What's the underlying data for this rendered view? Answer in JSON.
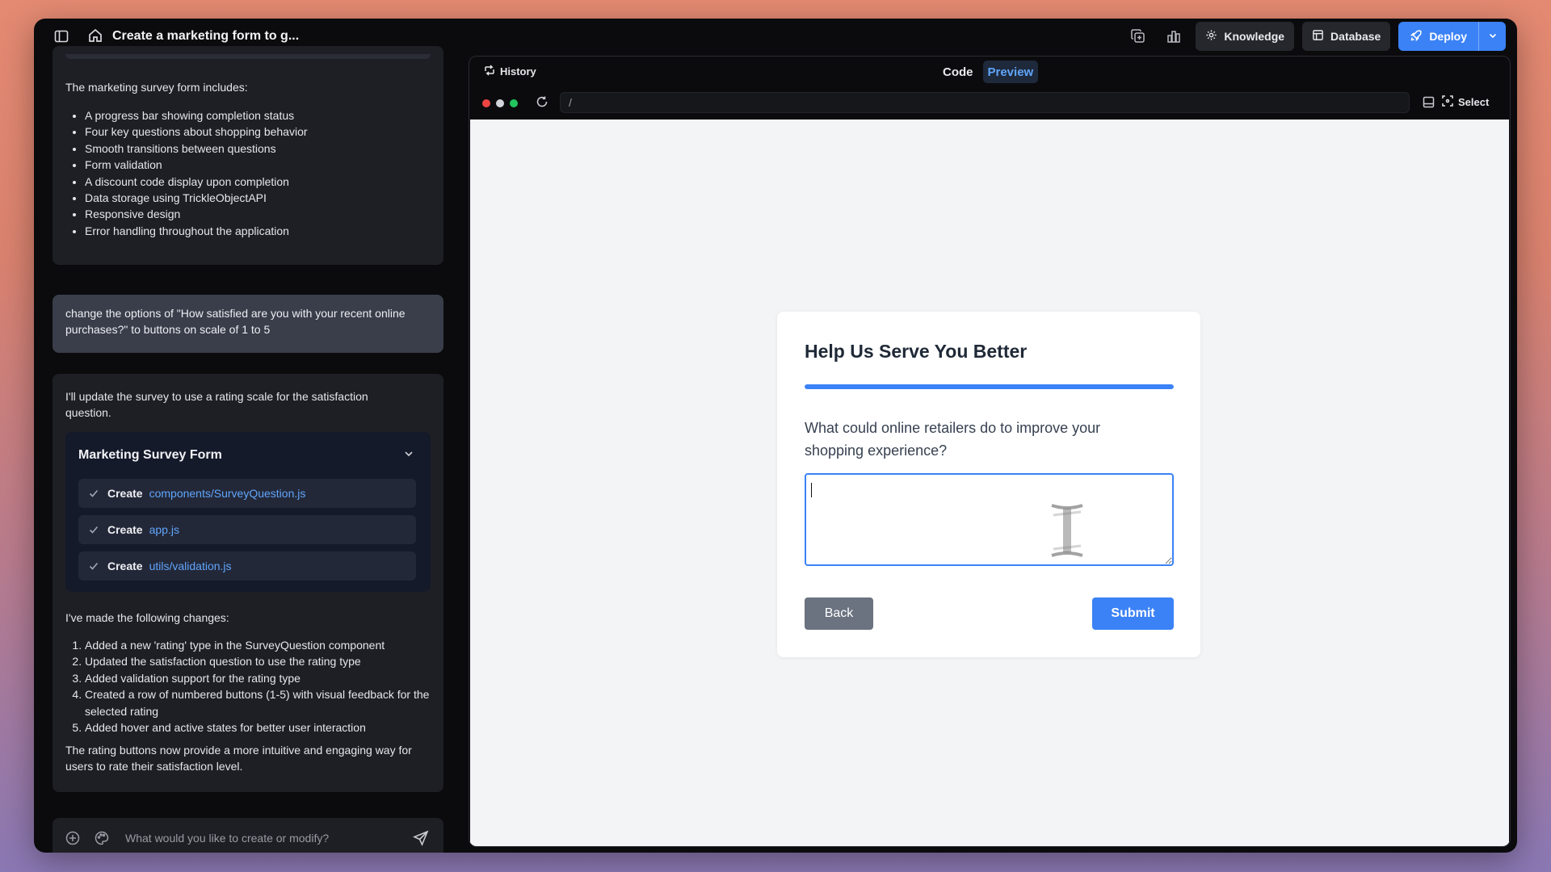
{
  "window": {
    "title": "Create a marketing form to g..."
  },
  "toolbar": {
    "knowledge_label": "Knowledge",
    "database_label": "Database",
    "deploy_label": "Deploy"
  },
  "chat": {
    "summary_intro": "The marketing survey form includes:",
    "summary_items": [
      "A progress bar showing completion status",
      "Four key questions about shopping behavior",
      "Smooth transitions between questions",
      "Form validation",
      "A discount code display upon completion",
      "Data storage using TrickleObjectAPI",
      "Responsive design",
      "Error handling throughout the application"
    ],
    "user_message": "change the options of \"How satisfied are you with your recent online purchases?\" to buttons on scale of 1 to 5",
    "assistant_lead": "I'll update the survey to use a rating scale for the satisfaction question.",
    "artifact": {
      "title": "Marketing Survey Form",
      "files": [
        {
          "verb": "Create",
          "path": "components/SurveyQuestion.js"
        },
        {
          "verb": "Create",
          "path": "app.js"
        },
        {
          "verb": "Create",
          "path": "utils/validation.js"
        }
      ]
    },
    "changes_heading": "I've made the following changes:",
    "changes": [
      "Added a new 'rating' type in the SurveyQuestion component",
      "Updated the satisfaction question to use the rating type",
      "Added validation support for the rating type",
      "Created a row of numbered buttons (1-5) with visual feedback for the selected rating",
      "Added hover and active states for better user interaction"
    ],
    "closing": "The rating buttons now provide a more intuitive and engaging way for users to rate their satisfaction level.",
    "composer_placeholder": "What would you like to create or modify?"
  },
  "preview_panel": {
    "history_label": "History",
    "tab_code": "Code",
    "tab_preview": "Preview",
    "address": "/",
    "select_label": "Select",
    "traffic_colors": [
      "#ef4444",
      "#d1d5db",
      "#22c55e"
    ]
  },
  "form": {
    "title": "Help Us Serve You Better",
    "progress_fraction": 1.0,
    "question": "What could online retailers do to improve your shopping experience?",
    "answer_value": "",
    "back_label": "Back",
    "submit_label": "Submit"
  },
  "colors": {
    "accent": "#3b82f6",
    "link": "#60a5fa"
  }
}
